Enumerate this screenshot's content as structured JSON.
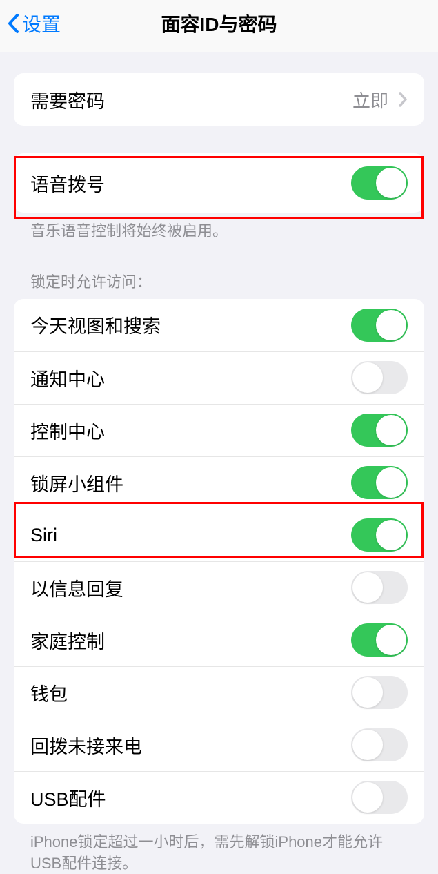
{
  "header": {
    "back": "设置",
    "title": "面容ID与密码"
  },
  "passcode": {
    "label": "需要密码",
    "value": "立即"
  },
  "voiceDial": {
    "label": "语音拨号",
    "on": true,
    "footnote": "音乐语音控制将始终被启用。"
  },
  "lockAccess": {
    "header": "锁定时允许访问：",
    "items": [
      {
        "label": "今天视图和搜索",
        "on": true
      },
      {
        "label": "通知中心",
        "on": false
      },
      {
        "label": "控制中心",
        "on": true
      },
      {
        "label": "锁屏小组件",
        "on": true
      },
      {
        "label": "Siri",
        "on": true
      },
      {
        "label": "以信息回复",
        "on": false
      },
      {
        "label": "家庭控制",
        "on": true
      },
      {
        "label": "钱包",
        "on": false
      },
      {
        "label": "回拨未接来电",
        "on": false
      },
      {
        "label": "USB配件",
        "on": false
      }
    ],
    "footnote": "iPhone锁定超过一小时后，需先解锁iPhone才能允许USB配件连接。"
  }
}
